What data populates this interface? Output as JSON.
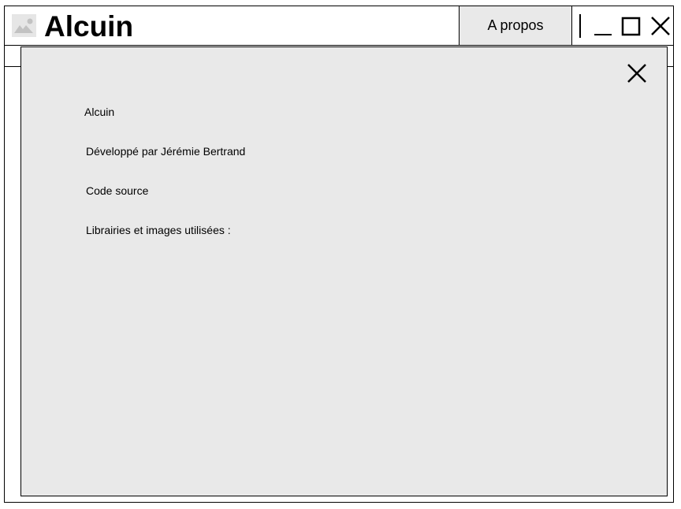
{
  "window": {
    "title": "Alcuin",
    "about_tab_label": "A propos",
    "icon": "image-placeholder-icon"
  },
  "window_controls": {
    "minimize_icon": "minimize-icon",
    "maximize_icon": "maximize-icon",
    "close_icon": "close-icon"
  },
  "about_dialog": {
    "app_name": "Alcuin",
    "developer": "Développé par Jérémie Bertrand",
    "source_code": "Code source",
    "libraries": "Librairies et images utilisées :",
    "close_icon": "close-icon"
  },
  "colors": {
    "panel_background": "#e9e9e9",
    "border": "#000000",
    "icon_placeholder": "#cccccc"
  }
}
